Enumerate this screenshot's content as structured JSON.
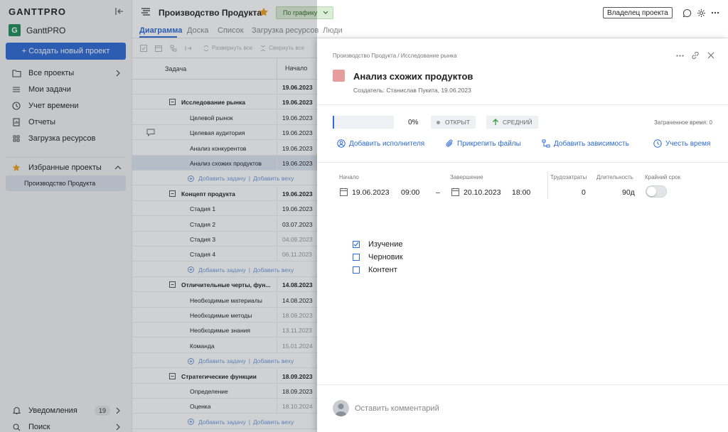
{
  "app": {
    "brand": "GANTTPRO",
    "workspace": "GanttPRO"
  },
  "sidebar": {
    "create_button": "+  Создать новый проект",
    "items": [
      {
        "label": "Все проекты",
        "icon": "folder-icon"
      },
      {
        "label": "Мои задачи",
        "icon": "list-icon"
      },
      {
        "label": "Учет времени",
        "icon": "clock-icon"
      },
      {
        "label": "Отчеты",
        "icon": "report-icon"
      },
      {
        "label": "Загрузка ресурсов",
        "icon": "grid-icon"
      }
    ],
    "favorites_label": "Избранные проекты",
    "favorite_project": "Производство Продукта",
    "notifications_label": "Уведомления",
    "notifications_count": "19",
    "search_label": "Поиск"
  },
  "header": {
    "project_title": "Производство Продукта",
    "status": "По графику",
    "owner_button": "Владелец проекта",
    "tabs": [
      "Диаграмма",
      "Доска",
      "Список",
      "Загрузка ресурсов",
      "Люди"
    ]
  },
  "gantt": {
    "toolbar": {
      "expand_all": "Развернуть все",
      "collapse_all": "Свернуть все"
    },
    "columns": {
      "task": "Задача",
      "start": "Начало"
    },
    "add_task": "Добавить задачу",
    "add_milestone": "Добавить веху",
    "rows": [
      {
        "type": "project",
        "name": "",
        "start": "19.06.2023"
      },
      {
        "type": "group",
        "name": "Исследование рынка",
        "start": "19.06.2023"
      },
      {
        "type": "task",
        "name": "Целевой рынок",
        "start": "19.06.2023"
      },
      {
        "type": "task",
        "name": "Целевая аудитория",
        "start": "19.06.2023",
        "comment": true
      },
      {
        "type": "task",
        "name": "Анализ конкурентов",
        "start": "19.06.2023"
      },
      {
        "type": "task",
        "name": "Анализ схожих продуктов",
        "start": "19.06.2023",
        "selected": true
      },
      {
        "type": "add"
      },
      {
        "type": "group",
        "name": "Концепт продукта",
        "start": "19.06.2023",
        "light": true
      },
      {
        "type": "task",
        "name": "Стадия 1",
        "start": "19.06.2023"
      },
      {
        "type": "task",
        "name": "Стадия 2",
        "start": "03.07.2023"
      },
      {
        "type": "task",
        "name": "Стадия 3",
        "start": "04.09.2023",
        "gray": true
      },
      {
        "type": "task",
        "name": "Стадия 4",
        "start": "06.11.2023",
        "gray": true
      },
      {
        "type": "add"
      },
      {
        "type": "group",
        "name": "Отличительные черты, фун...",
        "start": "14.08.2023"
      },
      {
        "type": "task",
        "name": "Необходимые материалы",
        "start": "14.08.2023"
      },
      {
        "type": "task",
        "name": "Необходимые методы",
        "start": "18.09.2023",
        "gray": true
      },
      {
        "type": "task",
        "name": "Необходимые знания",
        "start": "13.11.2023",
        "gray": true
      },
      {
        "type": "task",
        "name": "Команда",
        "start": "15.01.2024",
        "gray": true
      },
      {
        "type": "add"
      },
      {
        "type": "group",
        "name": "Стратегические функции",
        "start": "18.09.2023"
      },
      {
        "type": "task",
        "name": "Определение",
        "start": "18.09.2023"
      },
      {
        "type": "task",
        "name": "Оценка",
        "start": "18.10.2024",
        "gray": true
      },
      {
        "type": "add"
      }
    ]
  },
  "task_panel": {
    "breadcrumb": "Производство Продукта / Исследование рынка",
    "title": "Анализ схожих продуктов",
    "creator": "Создатель: Станислав Пукита, 19.06.2023",
    "color": "#e79d9d",
    "progress_text": "0%",
    "progress": 0,
    "status": "ОТКРЫТ",
    "priority": "СРЕДНИЙ",
    "time_spent": "Затраченное время: 0",
    "actions": {
      "assign": "Добавить исполнителя",
      "attach": "Прикрепить файлы",
      "dependency": "Добавить зависимость",
      "time": "Учесть время"
    },
    "fields": {
      "start_label": "Начало",
      "start_date": "19.06.2023",
      "start_time": "09:00",
      "dash": "–",
      "end_label": "Завершение",
      "end_date": "20.10.2023",
      "end_time": "18:00",
      "effort_label": "Трудозатраты",
      "effort": "0",
      "duration_label": "Длительность",
      "duration": "90д",
      "deadline_label": "Крайний срок"
    },
    "checklist": [
      {
        "label": "Изучение",
        "checked": true
      },
      {
        "label": "Черновик",
        "checked": false
      },
      {
        "label": "Контент",
        "checked": false
      }
    ],
    "comment_placeholder": "Оставить комментарий"
  },
  "colors": {
    "accent": "#2d6bd6",
    "brand_green": "#1e8f5a",
    "status_bg": "#dbeed7"
  }
}
